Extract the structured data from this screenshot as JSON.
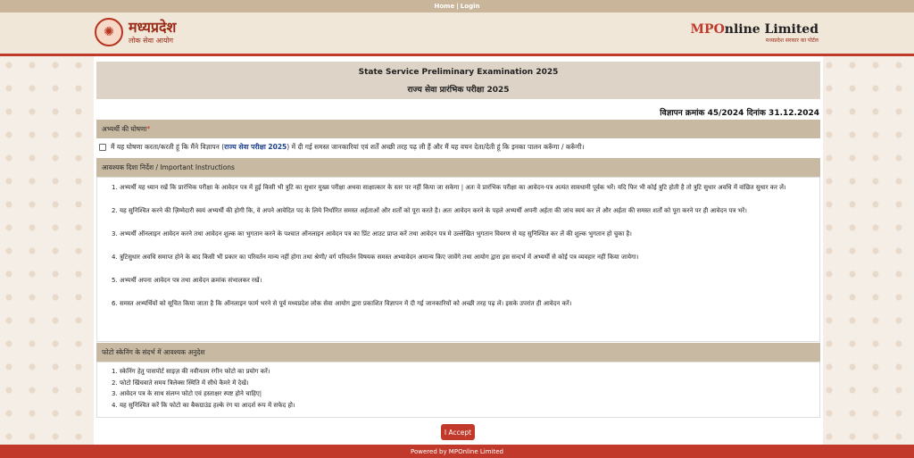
{
  "topbar": {
    "home": "Home",
    "separator": "|",
    "login": "Login"
  },
  "header": {
    "logo_title": "मध्यप्रदेश",
    "logo_subtitle": "लोक सेवा आयोग",
    "brand_mp": "MP",
    "brand_o": "O",
    "brand_rest": "nline Limited",
    "brand_tagline": "मध्यप्रदेश सरकार का पोर्टल"
  },
  "exam": {
    "title_en": "State Service Preliminary Examination 2025",
    "title_hi": "राज्य सेवा प्रारंभिक परीक्षा 2025",
    "advertisement": "विज्ञापन क्रमांक 45/2024 दिनांक 31.12.2024"
  },
  "declaration": {
    "header": "अभ्यर्थी की घोषणा",
    "required_mark": "*",
    "text_before": "मैं यह घोषणा करता/करती हूं कि मैंने विज्ञापन (",
    "link_text": "राज्य सेवा परीक्षा 2025",
    "text_after": ") में दी गई समस्त जानकारियां एवं शर्तें अच्छी तरह पढ़ ली हैं और मैं यह वचन देता/देती हूं कि इनका पालन करूँगा / करूँगी।"
  },
  "instructions": {
    "header": "आवश्यक दिशा निर्देश / Important Instructions",
    "items": [
      {
        "num": "1.",
        "text": "अभ्यर्थी यह ध्यान रखें कि प्रारंभिक परीक्षा के आवेदन पत्र में हुई किसी भी त्रुटि का सुधार मुख्य परीक्षा अथवा साक्षात्कार के स्तर पर नहीं किया जा सकेगा | अतः वे प्रारंभिक परीक्षा का आवेदन-पत्र अत्यंत सावधानी पूर्वक भरें। यदि फिर भी कोई त्रुटि होती है तो त्रुटि सुधार अवधि में वांछित सुधार कर लें।"
      },
      {
        "num": "2.",
        "text": "यह सुनिश्चित करने की ज़िम्मेदारी स्वयं अभ्यर्थी की होगी कि, वे अपने आवेदित पद के लिये निर्धारित समस्त अर्हताओं और शर्तों को पूरा करते है। अतः आवेदन करने के पहले अभ्यर्थी अपनी अर्हता की जांच स्वयं कर लें और अर्हता की समस्त शर्तों को पूरा करने पर ही आवेदन पत्र भरें।"
      },
      {
        "num": "3.",
        "text": "अभ्यर्थी ऑनलाइन आवेदन करने तथा आवेदन शुल्क का भुगतान करने के पश्चात ऑनलाइन आवेदन पत्र का प्रिंट आउट प्राप्त करें तथा आवेदन पत्र मे उल्लेखित भुगतान विवरण से यह सुनिश्चित कर लें की शुल्क भुगतान हो चुका है।"
      },
      {
        "num": "4.",
        "text": "त्रुटिसुधार अवधि समाप्त होने के बाद किसी भी प्रकार का परिवर्तन मान्य नहीं होगा तथा श्रेणी/ वर्ग परिवर्तन विषयक समस्त अभ्यावेदन अमान्य किए जावेंगे तथा आयोग द्वारा इस सन्दर्भ में अभ्यर्थी से कोई पत्र व्यवहार नहीं किया जायेगा।"
      },
      {
        "num": "5.",
        "text": "अभ्यर्थी अपना आवेदन पत्र तथा आवेदन क्रमांक संभालकर रखें।"
      },
      {
        "num": "6.",
        "text": "समस्त अभ्यर्थियों को सूचित किया जाता है कि ऑनलाइन फार्म भरने से पूर्व मध्यप्रदेश लोक सेवा आयोग द्वारा प्रकाशित विज्ञापन में दी गई जानकारियों को अच्छी तरह पढ़ लें। इसके उपरांत ही आवेदन करें।"
      }
    ]
  },
  "photo": {
    "header": "फोटो स्केनिंग के संदर्भ में आवश्यक अनुदेश",
    "items": [
      {
        "num": "1.",
        "text": "स्केनिंग हेतु पासपोर्ट साइज़ की नवीनतम रंगीन फोटो का प्रयोग करें।"
      },
      {
        "num": "2.",
        "text": "फोटो खिंचवाते समय त्रिलेक्स स्थिति में सीधे कैमरे में देखें।"
      },
      {
        "num": "3.",
        "text": "आवेदन पत्र के साथ संलग्न फोटो एवं हस्ताक्षर स्पष्ट होने चाहिए|"
      },
      {
        "num": "4.",
        "text": "यह सुनिश्चित करें कि फोटो का बैकग्राउंड हल्के रंग या आदर्श रूप में सफेद हो।"
      }
    ]
  },
  "accept_button": "I Accept",
  "footer": "Powered by MPOnline Limited",
  "colors": {
    "accent_red": "#c0392b",
    "section_bar": "#c8b9a2",
    "topbar": "#c9b69a"
  }
}
